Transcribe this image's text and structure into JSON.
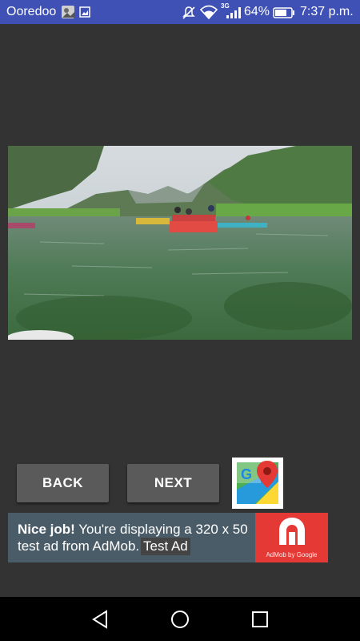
{
  "status_bar": {
    "carrier": "Ooredoo",
    "network_label": "3G",
    "battery_percent": "64%",
    "time": "7:37 p.m.",
    "icons": [
      "image-notification-icon",
      "photo-notification-icon",
      "mute-icon",
      "wifi-icon",
      "signal-icon",
      "battery-icon"
    ]
  },
  "buttons": {
    "back_label": "BACK",
    "next_label": "NEXT"
  },
  "maps_button": {
    "icon": "google-maps-icon",
    "letter": "G"
  },
  "ad": {
    "bold": "Nice job!",
    "text": " You're displaying a 320 x 50 test ad from AdMob.",
    "logo_caption": "AdMob by Google",
    "overlay_label": "Test Ad"
  },
  "navigation": {
    "icons": [
      "back-icon",
      "home-icon",
      "recents-icon"
    ]
  },
  "colors": {
    "status_bar": "#3f51b5",
    "background": "#333333",
    "button": "#5a5a5a",
    "ad_background": "#4a5c68",
    "ad_logo": "#e53935"
  }
}
